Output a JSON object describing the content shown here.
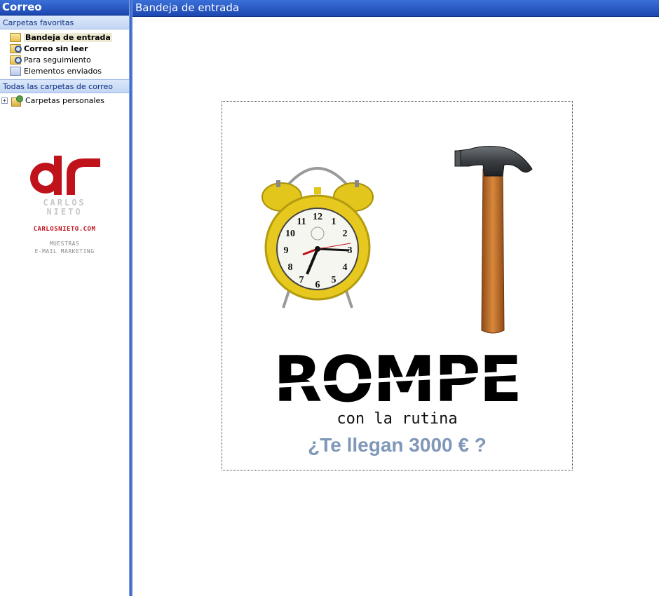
{
  "nav": {
    "title": "Correo",
    "favorites_header": "Carpetas favoritas",
    "favorites": [
      {
        "label": "Bandeja de entrada",
        "icon": "inbox-folder-icon",
        "bold": true,
        "selected": true
      },
      {
        "label": "Correo sin leer",
        "icon": "search-folder-icon",
        "bold": true,
        "selected": false
      },
      {
        "label": "Para seguimiento",
        "icon": "search-folder-icon",
        "bold": false,
        "selected": false
      },
      {
        "label": "Elementos enviados",
        "icon": "sent-folder-icon",
        "bold": false,
        "selected": false
      }
    ],
    "all_folders_header": "Todas las carpetas de correo",
    "tree": [
      {
        "label": "Carpetas personales",
        "expander": "+",
        "icon": "personal-folders-icon"
      }
    ],
    "brand": {
      "logo_letters": "dr",
      "name_line1": "CARLOS",
      "name_line2": "NIETO",
      "url": "CARLOSNIETO.COM",
      "tagline1": "MUESTRAS",
      "tagline2": "E-MAIL MARKETING",
      "logo_color": "#c0121b"
    }
  },
  "main": {
    "title": "Bandeja de entrada",
    "banner": {
      "clock_icon": "alarm-clock-icon",
      "hammer_icon": "hammer-icon",
      "headline": "ROMPE",
      "subline": "con la rutina",
      "question": "¿Te llegan 3000 € ?",
      "question_color": "#7f97b8"
    }
  },
  "colors": {
    "header_blue": "#1c48b0",
    "section_blue": "#c3d6f3"
  }
}
